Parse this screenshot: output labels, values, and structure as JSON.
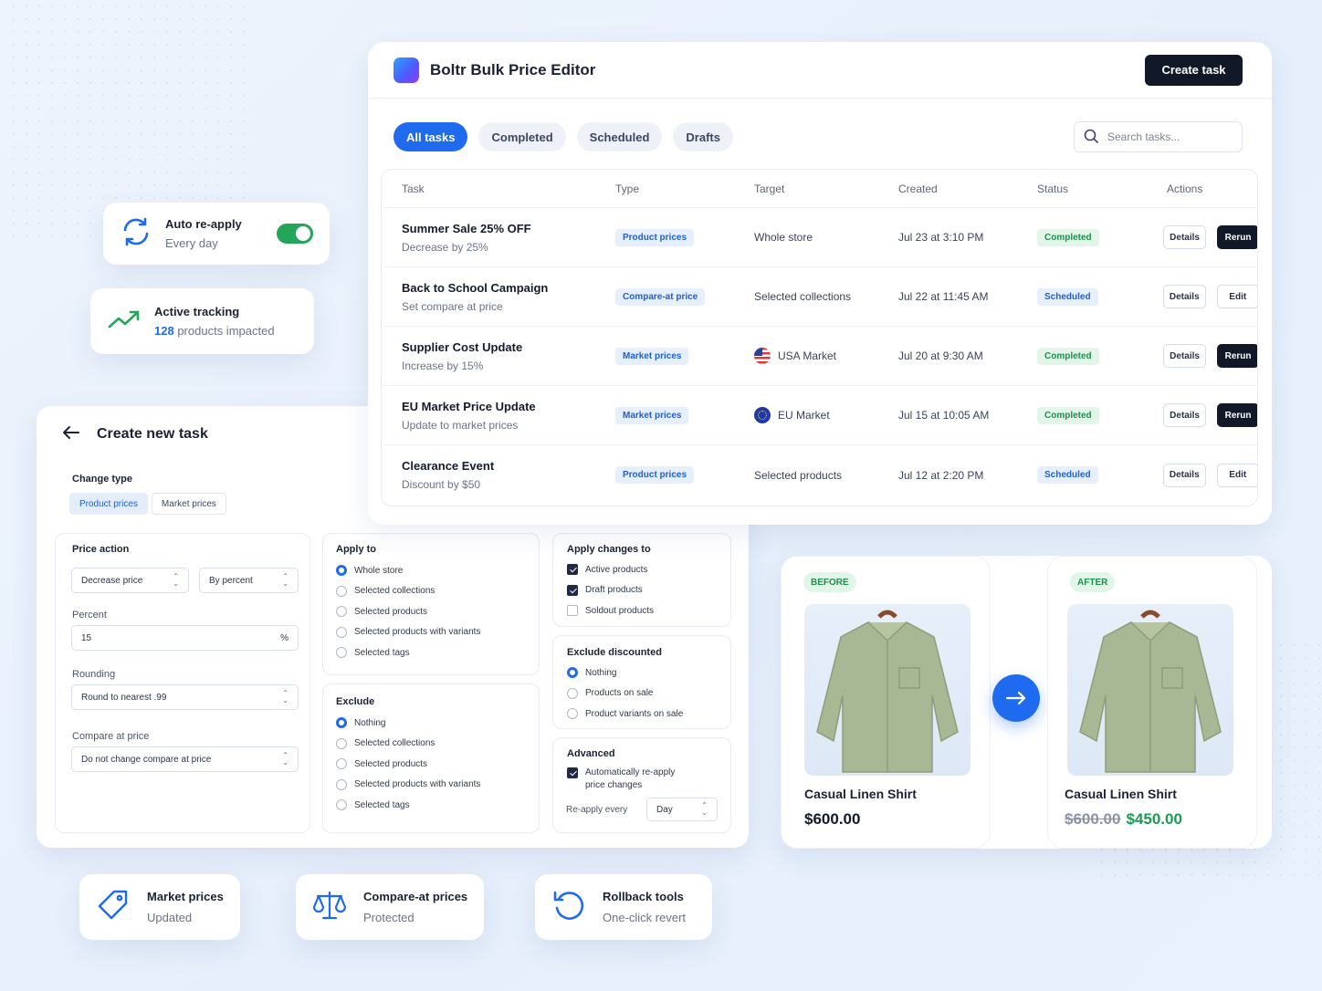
{
  "auto_reapply": {
    "title": "Auto re-apply",
    "subtitle": "Every day",
    "enabled": true
  },
  "tracking": {
    "title": "Active tracking",
    "count": "128",
    "suffix": "products impacted"
  },
  "app": {
    "title": "Boltr Bulk Price Editor",
    "create_button": "Create task"
  },
  "tabs": [
    {
      "label": "All tasks",
      "active": true
    },
    {
      "label": "Completed",
      "active": false
    },
    {
      "label": "Scheduled",
      "active": false
    },
    {
      "label": "Drafts",
      "active": false
    }
  ],
  "search": {
    "placeholder": "Search tasks..."
  },
  "table": {
    "headers": [
      "Task",
      "Type",
      "Target",
      "Created",
      "Status",
      "Actions"
    ],
    "rows": [
      {
        "name": "Summer Sale 25% OFF",
        "desc": "Decrease by 25%",
        "type": "Product prices",
        "target": "Whole store",
        "flag": "",
        "created": "Jul 23 at 3:10 PM",
        "status": "Completed",
        "action1": "Details",
        "action2": "Rerun"
      },
      {
        "name": "Back to School Campaign",
        "desc": "Set compare at price",
        "type": "Compare-at price",
        "target": "Selected collections",
        "flag": "",
        "created": "Jul 22 at 11:45 AM",
        "status": "Scheduled",
        "action1": "Details",
        "action2": "Edit"
      },
      {
        "name": "Supplier Cost Update",
        "desc": "Increase by 15%",
        "type": "Market prices",
        "target": "USA Market",
        "flag": "us",
        "created": "Jul 20 at 9:30 AM",
        "status": "Completed",
        "action1": "Details",
        "action2": "Rerun"
      },
      {
        "name": "EU Market Price Update",
        "desc": "Update to market prices",
        "type": "Market prices",
        "target": "EU Market",
        "flag": "eu",
        "created": "Jul 15 at 10:05 AM",
        "status": "Completed",
        "action1": "Details",
        "action2": "Rerun"
      },
      {
        "name": "Clearance Event",
        "desc": "Discount by $50",
        "type": "Product prices",
        "target": "Selected products",
        "flag": "",
        "created": "Jul 12 at 2:20 PM",
        "status": "Scheduled",
        "action1": "Details",
        "action2": "Edit"
      }
    ]
  },
  "create_task": {
    "title": "Create new task",
    "change_type": {
      "label": "Change type",
      "options": [
        "Product prices",
        "Market prices"
      ],
      "selected": "Product prices"
    },
    "price_action": {
      "label": "Price action",
      "action_value": "Decrease price",
      "mode_value": "By percent",
      "percent_label": "Percent",
      "percent_value": "15",
      "percent_unit": "%",
      "rounding_label": "Rounding",
      "rounding_value": "Round to nearest .99",
      "compare_label": "Compare at price",
      "compare_value": "Do not change compare at price"
    },
    "apply_to": {
      "label": "Apply to",
      "options": [
        "Whole store",
        "Selected collections",
        "Selected products",
        "Selected products with variants",
        "Selected tags"
      ],
      "selected": "Whole store"
    },
    "exclude": {
      "label": "Exclude",
      "options": [
        "Nothing",
        "Selected collections",
        "Selected products",
        "Selected products with variants",
        "Selected tags"
      ],
      "selected": "Nothing"
    },
    "apply_changes_to": {
      "label": "Apply changes to",
      "options": [
        {
          "label": "Active products",
          "checked": true
        },
        {
          "label": "Draft products",
          "checked": true
        },
        {
          "label": "Soldout products",
          "checked": false
        }
      ]
    },
    "exclude_discounted": {
      "label": "Exclude discounted",
      "options": [
        "Nothing",
        "Products on sale",
        "Product variants on sale"
      ],
      "selected": "Nothing"
    },
    "advanced": {
      "label": "Advanced",
      "auto_reapply_line1": "Automatically re-apply",
      "auto_reapply_line2": "price changes",
      "auto_reapply_checked": true,
      "reapply_label": "Re-apply every",
      "reapply_value": "Day"
    }
  },
  "before_after": {
    "before": {
      "tag": "BEFORE",
      "name": "Casual Linen Shirt",
      "price": "$600.00"
    },
    "after": {
      "tag": "AFTER",
      "name": "Casual Linen Shirt",
      "old_price": "$600.00",
      "new_price": "$450.00"
    }
  },
  "features": [
    {
      "title": "Market prices",
      "subtitle": "Updated",
      "icon": "tag-icon"
    },
    {
      "title": "Compare-at prices",
      "subtitle": "Protected",
      "icon": "scale-icon"
    },
    {
      "title": "Rollback tools",
      "subtitle": "One-click revert",
      "icon": "rollback-icon"
    }
  ],
  "colors": {
    "accent": "#1e6bf0",
    "dark": "#111827",
    "success": "#1f8f4d",
    "success_bg": "#e2f5e9",
    "info_bg": "#e6effd"
  }
}
